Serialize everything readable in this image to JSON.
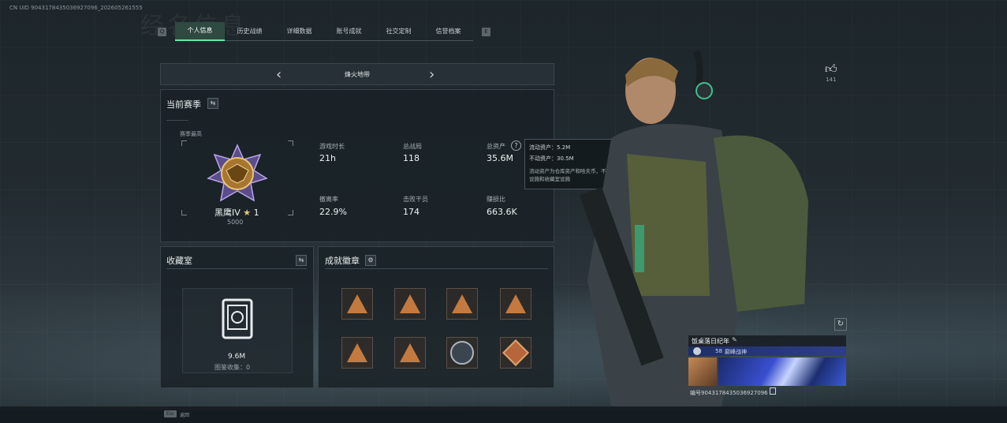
{
  "header": {
    "uid": "CN UID 9043178435036927096_202605261555",
    "ghost_title": "经名信息",
    "tabs": [
      {
        "label": "个人信息",
        "active": true
      },
      {
        "label": "历史战绩",
        "active": false
      },
      {
        "label": "详细数据",
        "active": false
      },
      {
        "label": "账号成就",
        "active": false
      },
      {
        "label": "社交定制",
        "active": false
      },
      {
        "label": "信誉档案",
        "active": false
      }
    ],
    "key_left": "Q",
    "key_right": "E"
  },
  "mode": {
    "name": "烽火地带"
  },
  "season": {
    "title": "当前赛季",
    "highest_label": "赛季最高",
    "rank_name": "黑鹰IV",
    "rank_stars": "1",
    "rank_points": "5000",
    "stats": [
      {
        "label": "游戏时长",
        "value": "21h"
      },
      {
        "label": "总战局",
        "value": "118"
      },
      {
        "label": "总资产",
        "value": "35.6M"
      },
      {
        "label": "撤离率",
        "value": "22.9%"
      },
      {
        "label": "击败干员",
        "value": "174"
      },
      {
        "label": "赚损比",
        "value": "663.6K"
      }
    ]
  },
  "tooltip": {
    "liquid": "流动资产：5.2M",
    "fixed": "不动资产：30.5M",
    "note": "流动资产为仓库资产和哈夫币，不动资产为特勤处设施和收藏室设施"
  },
  "collection": {
    "title": "收藏室",
    "value": "9.6M",
    "count_label": "图鉴收集：0"
  },
  "badges": {
    "title": "成就徽章",
    "items": [
      "triangle",
      "triangle",
      "triangle",
      "triangle",
      "triangle",
      "triangle",
      "circle",
      "diamond"
    ]
  },
  "likes": {
    "count": "141"
  },
  "card": {
    "name": "饭桌落日纪年",
    "level": "58",
    "level_label": "巅峰战神",
    "id_text": "编号9043178435036927096"
  },
  "footer": {
    "key": "Esc",
    "label": "返回"
  },
  "colors": {
    "accent": "#6ae7a2",
    "badge": "#c47a3e"
  }
}
